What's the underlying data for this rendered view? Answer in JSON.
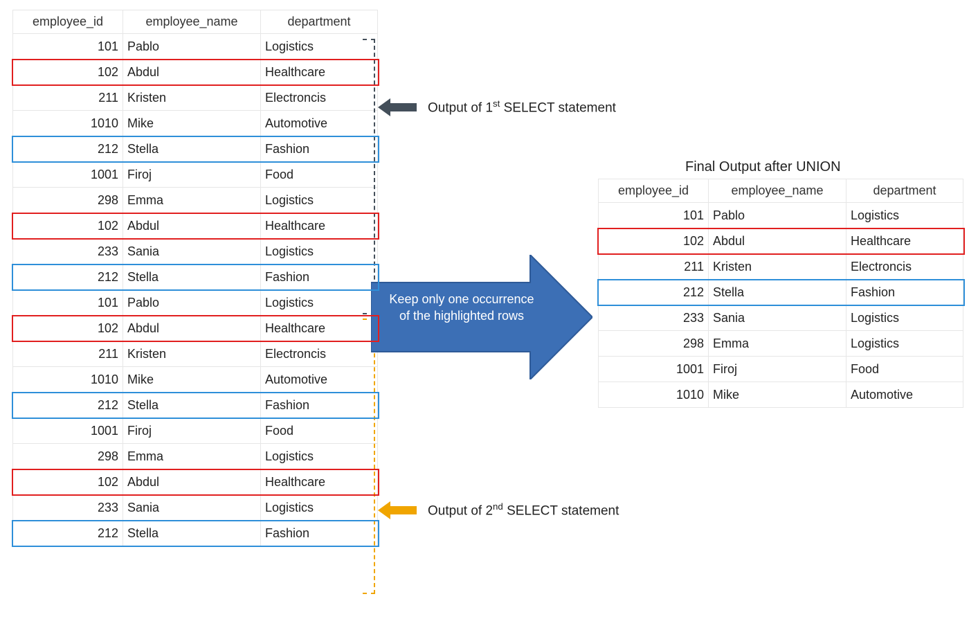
{
  "left_table": {
    "headers": [
      "employee_id",
      "employee_name",
      "department"
    ],
    "rows": [
      {
        "id": "101",
        "name": "Pablo",
        "dept": "Logistics",
        "hl": null
      },
      {
        "id": "102",
        "name": "Abdul",
        "dept": "Healthcare",
        "hl": "red"
      },
      {
        "id": "211",
        "name": "Kristen",
        "dept": "Electroncis",
        "hl": null
      },
      {
        "id": "1010",
        "name": "Mike",
        "dept": "Automotive",
        "hl": null
      },
      {
        "id": "212",
        "name": "Stella",
        "dept": "Fashion",
        "hl": "blue"
      },
      {
        "id": "1001",
        "name": "Firoj",
        "dept": "Food",
        "hl": null
      },
      {
        "id": "298",
        "name": "Emma",
        "dept": "Logistics",
        "hl": null
      },
      {
        "id": "102",
        "name": "Abdul",
        "dept": "Healthcare",
        "hl": "red"
      },
      {
        "id": "233",
        "name": "Sania",
        "dept": "Logistics",
        "hl": null
      },
      {
        "id": "212",
        "name": "Stella",
        "dept": "Fashion",
        "hl": "blue"
      },
      {
        "id": "101",
        "name": "Pablo",
        "dept": "Logistics",
        "hl": null
      },
      {
        "id": "102",
        "name": "Abdul",
        "dept": "Healthcare",
        "hl": "red"
      },
      {
        "id": "211",
        "name": "Kristen",
        "dept": "Electroncis",
        "hl": null
      },
      {
        "id": "1010",
        "name": "Mike",
        "dept": "Automotive",
        "hl": null
      },
      {
        "id": "212",
        "name": "Stella",
        "dept": "Fashion",
        "hl": "blue"
      },
      {
        "id": "1001",
        "name": "Firoj",
        "dept": "Food",
        "hl": null
      },
      {
        "id": "298",
        "name": "Emma",
        "dept": "Logistics",
        "hl": null
      },
      {
        "id": "102",
        "name": "Abdul",
        "dept": "Healthcare",
        "hl": "red"
      },
      {
        "id": "233",
        "name": "Sania",
        "dept": "Logistics",
        "hl": null
      },
      {
        "id": "212",
        "name": "Stella",
        "dept": "Fashion",
        "hl": "blue"
      }
    ]
  },
  "right_table": {
    "title": "Final Output after UNION",
    "headers": [
      "employee_id",
      "employee_name",
      "department"
    ],
    "rows": [
      {
        "id": "101",
        "name": "Pablo",
        "dept": "Logistics",
        "hl": null
      },
      {
        "id": "102",
        "name": "Abdul",
        "dept": "Healthcare",
        "hl": "red"
      },
      {
        "id": "211",
        "name": "Kristen",
        "dept": "Electroncis",
        "hl": null
      },
      {
        "id": "212",
        "name": "Stella",
        "dept": "Fashion",
        "hl": "blue"
      },
      {
        "id": "233",
        "name": "Sania",
        "dept": "Logistics",
        "hl": null
      },
      {
        "id": "298",
        "name": "Emma",
        "dept": "Logistics",
        "hl": null
      },
      {
        "id": "1001",
        "name": "Firoj",
        "dept": "Food",
        "hl": null
      },
      {
        "id": "1010",
        "name": "Mike",
        "dept": "Automotive",
        "hl": null
      }
    ]
  },
  "labels": {
    "select1_prefix": "Output of 1",
    "select1_sup": "st",
    "select1_suffix": " SELECT statement",
    "select2_prefix": "Output of 2",
    "select2_sup": "nd",
    "select2_suffix": " SELECT statement",
    "arrow_text": "Keep only one occurrence of the highlighted rows"
  },
  "colors": {
    "arrow_blue": "#3c6fb5",
    "arrow_dark": "#444f5a",
    "arrow_gold": "#f0a500",
    "hl_red": "#e11f1f",
    "hl_blue": "#2e8fd9"
  }
}
